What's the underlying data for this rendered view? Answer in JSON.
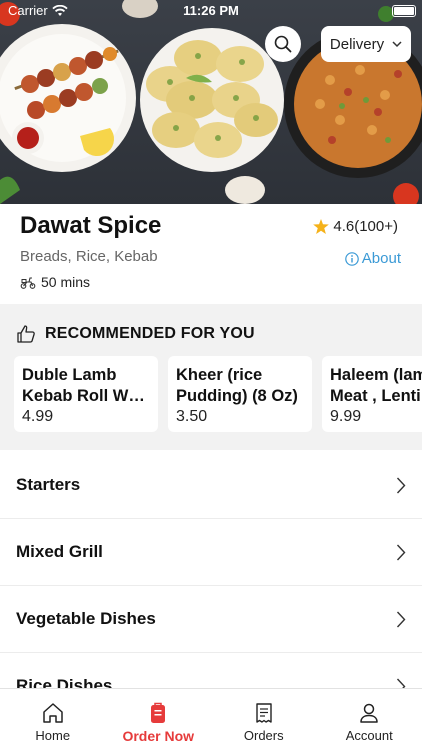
{
  "status_bar": {
    "carrier": "Carrier",
    "time": "11:26 PM"
  },
  "header": {
    "delivery_label": "Delivery"
  },
  "restaurant": {
    "name": "Dawat Spice",
    "rating": "4.6(100+)",
    "cuisine": "Breads, Rice, Kebab",
    "about_label": "About",
    "delivery_time": "50 mins"
  },
  "recommended": {
    "title": "RECOMMENDED FOR YOU",
    "items": [
      {
        "name": "Duble Lamb Kebab Roll W…",
        "price": "4.99"
      },
      {
        "name": "Kheer (rice Pudding) (8 Oz)",
        "price": "3.50"
      },
      {
        "name": "Haleem (lam Meat , Lenti",
        "price": "9.99"
      }
    ]
  },
  "categories": [
    {
      "label": "Starters"
    },
    {
      "label": "Mixed Grill"
    },
    {
      "label": "Vegetable Dishes"
    },
    {
      "label": "Rice Dishes"
    }
  ],
  "tabbar": {
    "tabs": [
      {
        "label": "Home",
        "icon": "home-icon"
      },
      {
        "label": "Order Now",
        "icon": "order-bag-icon"
      },
      {
        "label": "Orders",
        "icon": "receipt-icon"
      },
      {
        "label": "Account",
        "icon": "person-icon"
      }
    ]
  },
  "colors": {
    "accent": "#e63b3b",
    "link": "#3b9ad6",
    "star": "#f5b21a"
  }
}
